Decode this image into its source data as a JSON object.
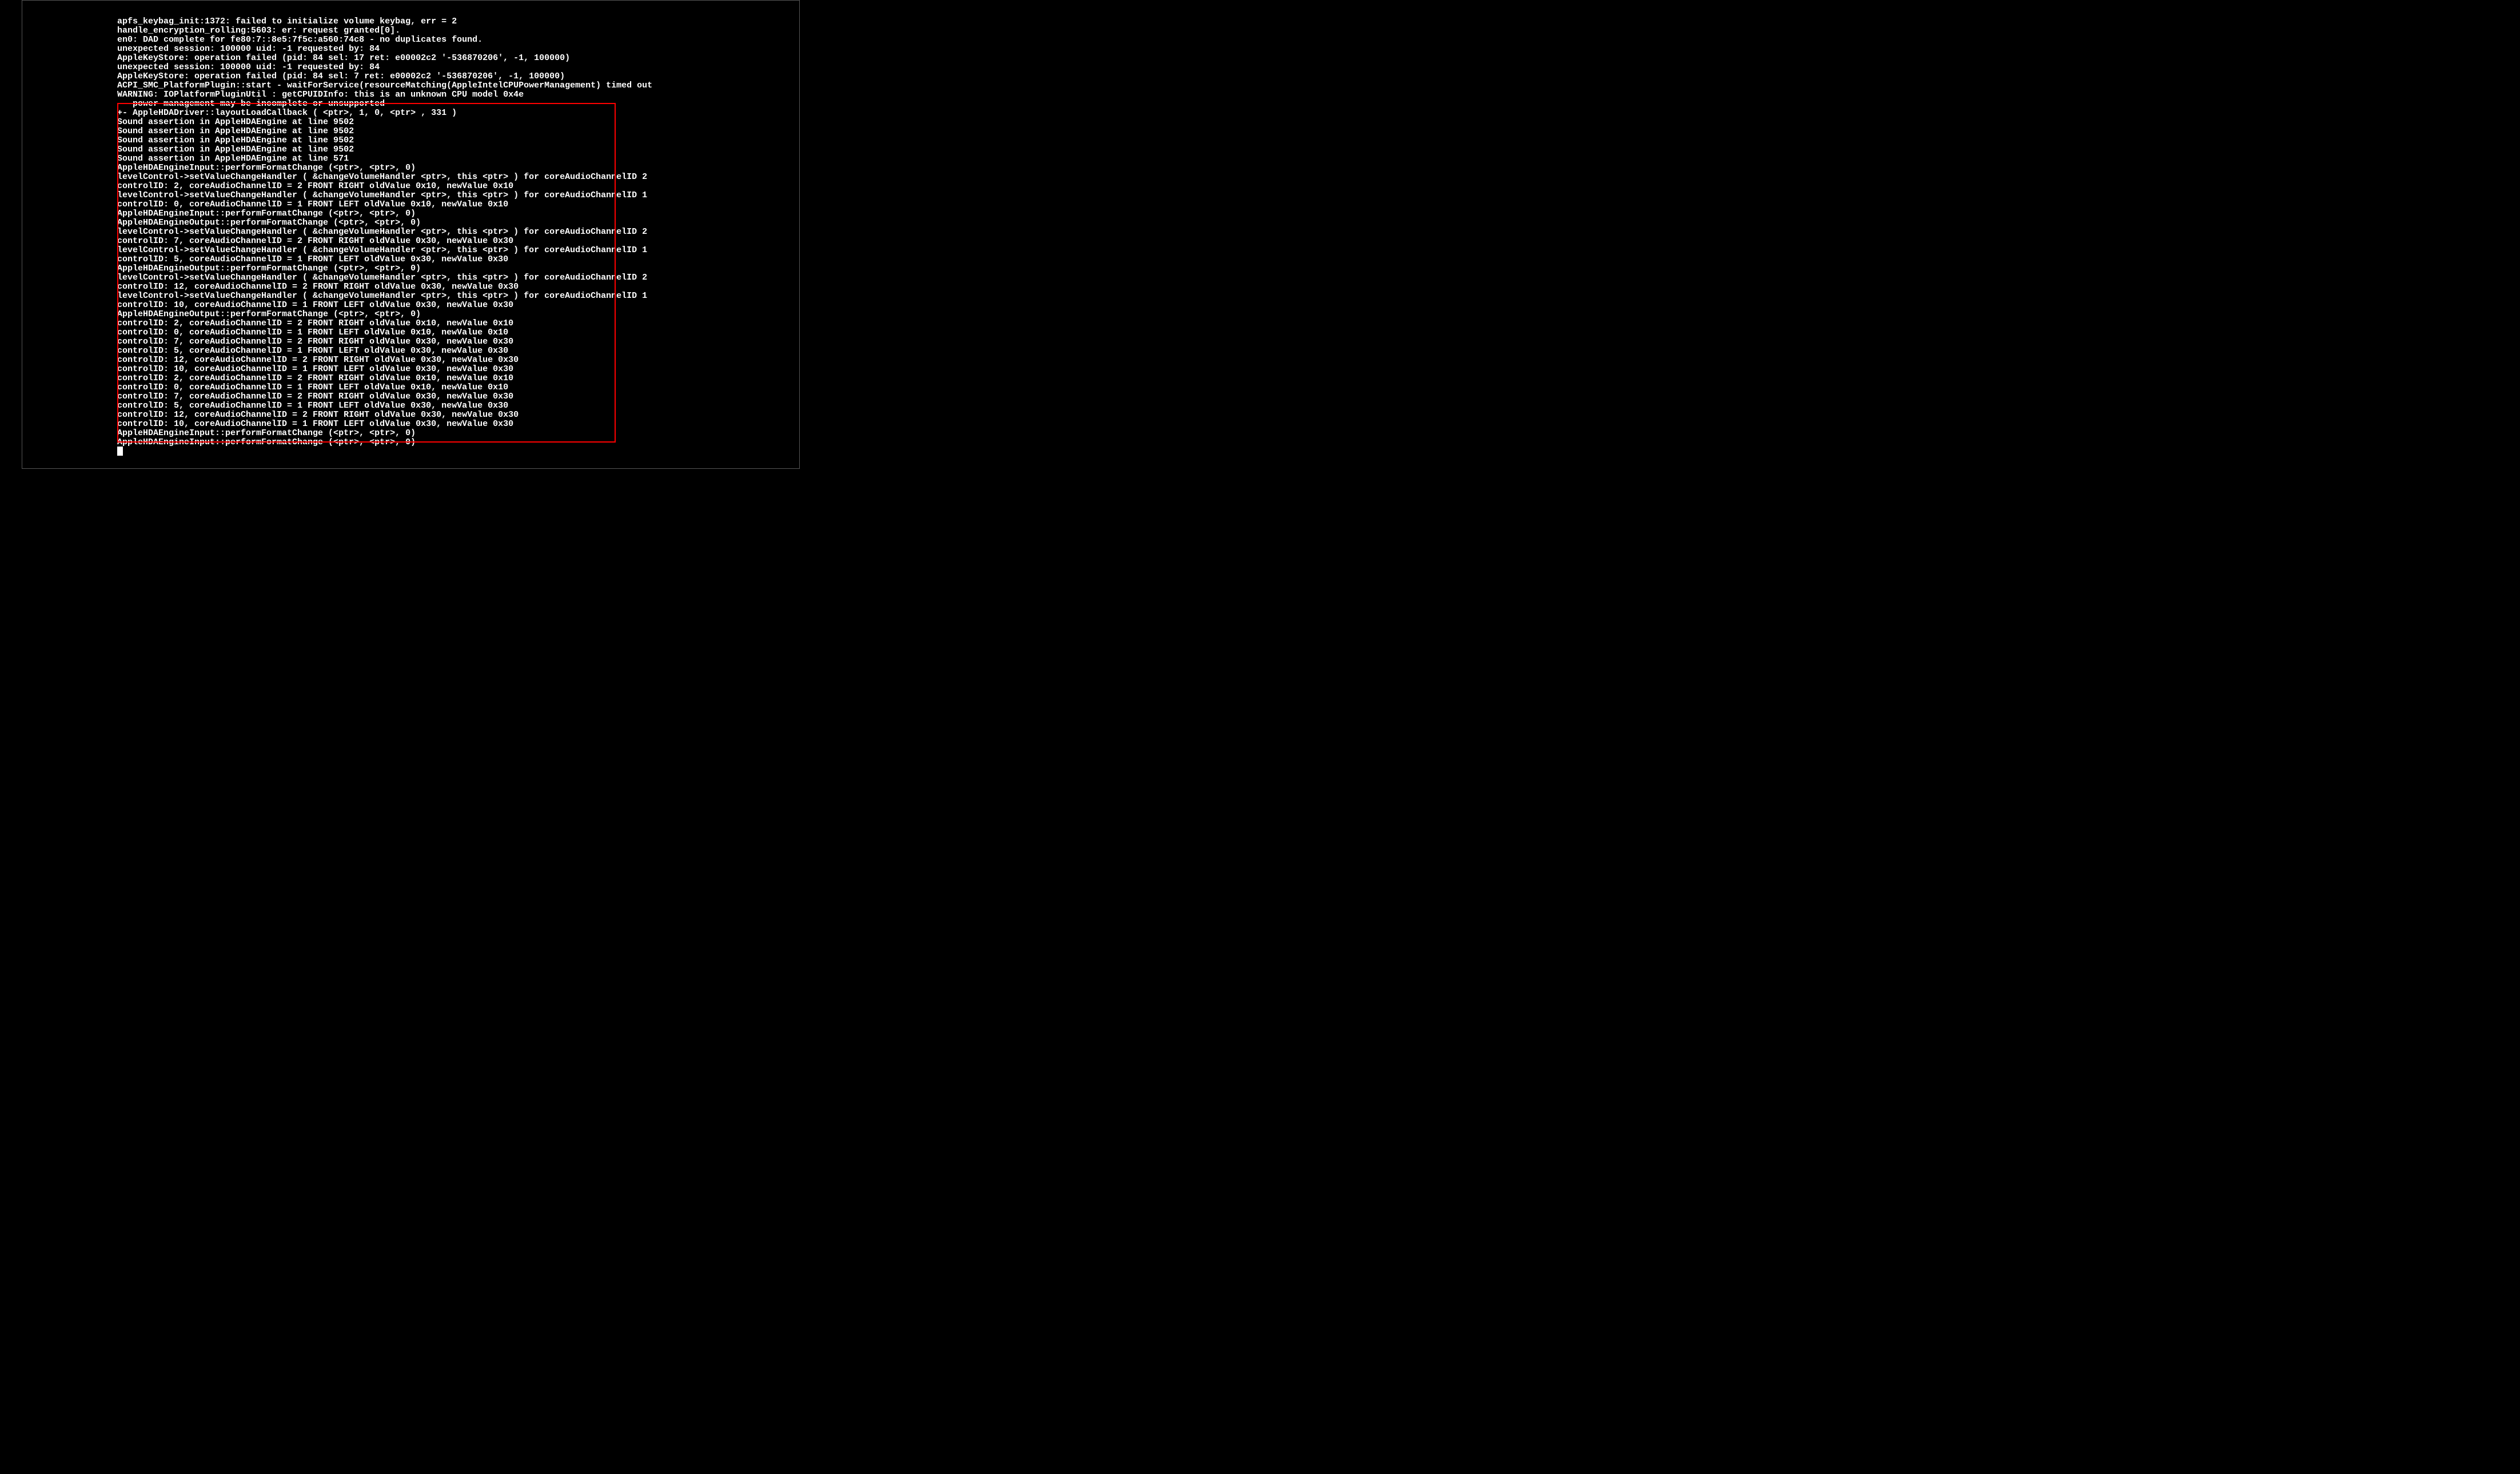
{
  "preLines": [
    "apfs_keybag_init:1372: failed to initialize volume keybag, err = 2",
    "handle_encryption_rolling:5603: er: request granted[0].",
    "en0: DAD complete for fe80:7::8e5:7f5c:a560:74c8 - no duplicates found.",
    "unexpected session: 100000 uid: -1 requested by: 84",
    "AppleKeyStore: operation failed (pid: 84 sel: 17 ret: e00002c2 '-536870206', -1, 100000)",
    "unexpected session: 100000 uid: -1 requested by: 84",
    "AppleKeyStore: operation failed (pid: 84 sel: 7 ret: e00002c2 '-536870206', -1, 100000)",
    "ACPI_SMC_PlatformPlugin::start - waitForService(resourceMatching(AppleIntelCPUPowerManagement) timed out",
    "WARNING: IOPlatformPluginUtil : getCPUIDInfo: this is an unknown CPU model 0x4e",
    "  -- power management may be incomplete or unsupported"
  ],
  "boxedLines": [
    "+- AppleHDADriver::layoutLoadCallback ( <ptr>, 1, 0, <ptr> , 331 )",
    "Sound assertion in AppleHDAEngine at line 9502",
    "Sound assertion in AppleHDAEngine at line 9502",
    "Sound assertion in AppleHDAEngine at line 9502",
    "Sound assertion in AppleHDAEngine at line 9502",
    "Sound assertion in AppleHDAEngine at line 571",
    "AppleHDAEngineInput::performFormatChange (<ptr>, <ptr>, 0)",
    "   levelControl->setValueChangeHandler ( &changeVolumeHandler <ptr>, this <ptr> ) for coreAudioChannelID 2",
    "   controlID: 2, coreAudioChannelID = 2 FRONT RIGHT oldValue 0x10, newValue 0x10",
    "   levelControl->setValueChangeHandler ( &changeVolumeHandler <ptr>, this <ptr> ) for coreAudioChannelID 1",
    "   controlID: 0, coreAudioChannelID = 1 FRONT LEFT oldValue 0x10, newValue 0x10",
    "AppleHDAEngineInput::performFormatChange (<ptr>, <ptr>, 0)",
    "AppleHDAEngineOutput::performFormatChange (<ptr>, <ptr>, 0)",
    "   levelControl->setValueChangeHandler ( &changeVolumeHandler <ptr>, this <ptr> ) for coreAudioChannelID 2",
    "   controlID: 7, coreAudioChannelID = 2 FRONT RIGHT oldValue 0x30, newValue 0x30",
    "   levelControl->setValueChangeHandler ( &changeVolumeHandler <ptr>, this <ptr> ) for coreAudioChannelID 1",
    "   controlID: 5, coreAudioChannelID = 1 FRONT LEFT oldValue 0x30, newValue 0x30",
    "AppleHDAEngineOutput::performFormatChange (<ptr>, <ptr>, 0)",
    "   levelControl->setValueChangeHandler ( &changeVolumeHandler <ptr>, this <ptr> ) for coreAudioChannelID 2",
    "   controlID: 12, coreAudioChannelID = 2 FRONT RIGHT oldValue 0x30, newValue 0x30",
    "   levelControl->setValueChangeHandler ( &changeVolumeHandler <ptr>, this <ptr> ) for coreAudioChannelID 1",
    "   controlID: 10, coreAudioChannelID = 1 FRONT LEFT oldValue 0x30, newValue 0x30",
    "AppleHDAEngineOutput::performFormatChange (<ptr>, <ptr>, 0)",
    "   controlID: 2, coreAudioChannelID = 2 FRONT RIGHT oldValue 0x10, newValue 0x10",
    "   controlID: 0, coreAudioChannelID = 1 FRONT LEFT oldValue 0x10, newValue 0x10",
    "   controlID: 7, coreAudioChannelID = 2 FRONT RIGHT oldValue 0x30, newValue 0x30",
    "   controlID: 5, coreAudioChannelID = 1 FRONT LEFT oldValue 0x30, newValue 0x30",
    "   controlID: 12, coreAudioChannelID = 2 FRONT RIGHT oldValue 0x30, newValue 0x30",
    "   controlID: 10, coreAudioChannelID = 1 FRONT LEFT oldValue 0x30, newValue 0x30",
    "   controlID: 2, coreAudioChannelID = 2 FRONT RIGHT oldValue 0x10, newValue 0x10",
    "   controlID: 0, coreAudioChannelID = 1 FRONT LEFT oldValue 0x10, newValue 0x10",
    "   controlID: 7, coreAudioChannelID = 2 FRONT RIGHT oldValue 0x30, newValue 0x30",
    "   controlID: 5, coreAudioChannelID = 1 FRONT LEFT oldValue 0x30, newValue 0x30",
    "   controlID: 12, coreAudioChannelID = 2 FRONT RIGHT oldValue 0x30, newValue 0x30",
    "   controlID: 10, coreAudioChannelID = 1 FRONT LEFT oldValue 0x30, newValue 0x30",
    "AppleHDAEngineInput::performFormatChange (<ptr>, <ptr>, 0)",
    "AppleHDAEngineInput::performFormatChange (<ptr>, <ptr>, 0)"
  ]
}
